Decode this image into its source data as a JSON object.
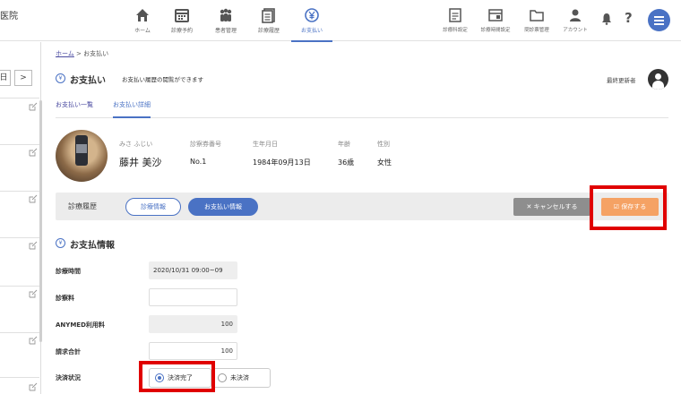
{
  "brand": {
    "text": "医院"
  },
  "nav": {
    "left": [
      {
        "label": "ホーム",
        "icon": "home-icon"
      },
      {
        "label": "診療予約",
        "icon": "calendar-icon"
      },
      {
        "label": "患者管理",
        "icon": "users-icon"
      },
      {
        "label": "診療履歴",
        "icon": "document-icon"
      },
      {
        "label": "お支払い",
        "icon": "yen-icon",
        "active": true
      }
    ],
    "right": [
      {
        "label": "診療科設定",
        "icon": "settings-doc-icon"
      },
      {
        "label": "診療時間設定",
        "icon": "schedule-icon"
      },
      {
        "label": "問診票管理",
        "icon": "folder-icon"
      },
      {
        "label": "アカウント",
        "icon": "account-icon"
      }
    ],
    "help": "?"
  },
  "left_pager": {
    "current": "日",
    "next": ">"
  },
  "breadcrumb": {
    "home": "ホーム",
    "sep": ">",
    "current": "お支払い"
  },
  "page": {
    "title": "お支払い",
    "description": "お支払い履歴の閲覧ができます",
    "updated_by_label": "最終更新者",
    "yen_symbol": "¥"
  },
  "tabs": [
    {
      "label": "お支払い一覧",
      "active": false
    },
    {
      "label": "お支払い詳細",
      "active": true
    }
  ],
  "patient": {
    "kana_name": "みさ ふじい",
    "card_label": "診察券番号",
    "dob_label": "生年月日",
    "age_label": "年齢",
    "gender_label": "性別",
    "name": "藤井 美沙",
    "card_no": "No.1",
    "dob": "1984年09月13日",
    "age": "36歳",
    "gender": "女性"
  },
  "actionbar": {
    "label": "診療履歴",
    "btn_medical": "診療情報",
    "btn_payment": "お支払い情報",
    "btn_cancel": "✕ キャンセルする",
    "btn_save": "☑ 保存する"
  },
  "payment": {
    "section_title": "お支払情報",
    "fields": [
      {
        "label": "診療時間",
        "value": "2020/10/31  09:00~09"
      },
      {
        "label": "診察料",
        "value": ""
      },
      {
        "label": "ANYMED利用料",
        "value": "100"
      },
      {
        "label": "請求合計",
        "value": "100"
      }
    ],
    "status_label": "決済状況",
    "status_options": [
      {
        "label": "決済完了",
        "checked": true
      },
      {
        "label": "未決済",
        "checked": false
      }
    ]
  },
  "colors": {
    "accent": "#4a72c4",
    "save": "#f5a264",
    "cancel": "#8e8e8e",
    "highlight": "#e00000"
  }
}
